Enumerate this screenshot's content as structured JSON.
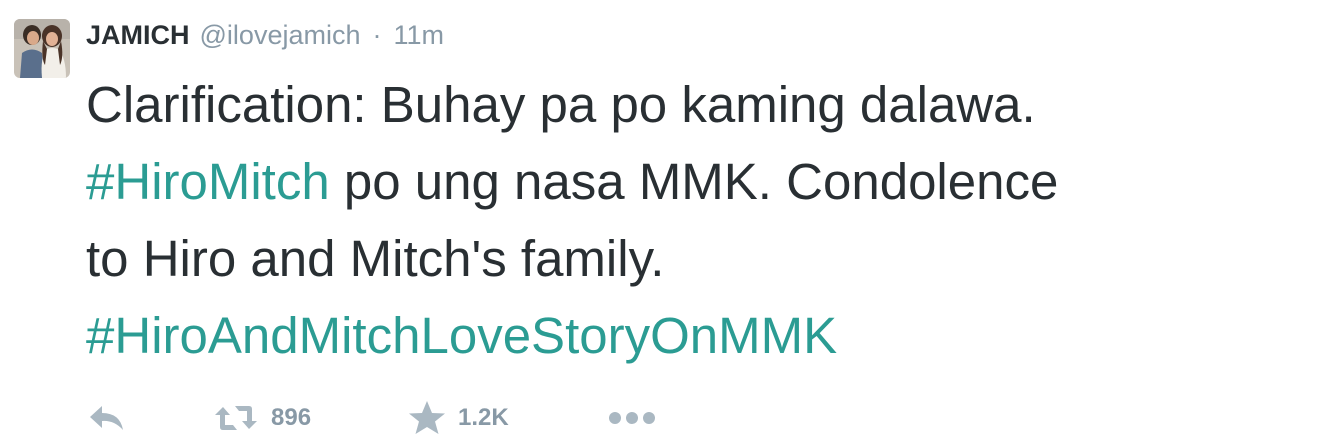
{
  "tweet": {
    "display_name": "JAMICH",
    "handle": "@ilovejamich",
    "separator": "·",
    "time": "11m",
    "text": {
      "part1": "Clarification: Buhay pa po kaming dalawa.",
      "hashtag1": "#HiroMitch",
      "part2": " po ung nasa MMK. Condolence",
      "part3": "to Hiro and Mitch's family.",
      "hashtag2": "#HiroAndMitchLoveStoryOnMMK"
    },
    "hashtag_color": "#2b9c93",
    "actions": {
      "reply_icon": "reply-icon",
      "retweet_icon": "retweet-icon",
      "retweet_count": "896",
      "favorite_icon": "star-icon",
      "favorite_count": "1.2K",
      "more_icon": "more-icon"
    }
  }
}
